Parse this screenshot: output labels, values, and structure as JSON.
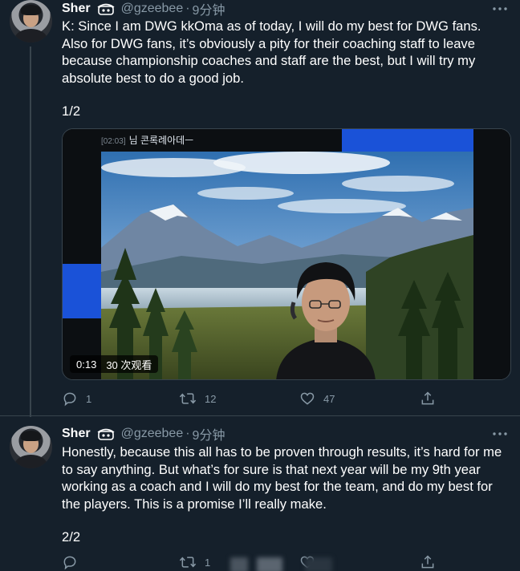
{
  "tweets": [
    {
      "author": {
        "name": "Sher",
        "handle": "@gzeebee",
        "separator": "·",
        "time": "9分钟"
      },
      "text": "K: Since I am DWG kkOma as of today, I will do my best for DWG fans. Also for DWG fans, it’s obviously a pity for their coaching staff to leave because championship coaches and staff are the best, but I will try my absolute best to do a good job.",
      "page": "1/2",
      "video": {
        "overlay_text": "님 콘록례아데ㅡ",
        "overlay_tag": "[02:03]",
        "duration": "0:13",
        "views": "30 次观看"
      },
      "actions": {
        "reply_count": "1",
        "retweet_count": "12",
        "like_count": "47"
      }
    },
    {
      "author": {
        "name": "Sher",
        "handle": "@gzeebee",
        "separator": "·",
        "time": "9分钟"
      },
      "text": "Honestly, because this all has to be proven through results, it’s hard for me to say anything. But what’s for sure is that next year will be my 9th year working as a coach and I will do my best for the team, and do my best for the players. This is a promise I’ll really make.",
      "page": "2/2",
      "actions": {
        "retweet_count": "1"
      }
    }
  ],
  "icons": {
    "more": "more-horizontal-icon",
    "reply": "reply-bubble-icon",
    "retweet": "retweet-arrows-icon",
    "like": "heart-icon",
    "share": "share-upload-icon",
    "emoji": "face-emoji-icon"
  },
  "colors": {
    "background": "#15202b",
    "secondary_text": "#8899a6",
    "divider": "#38444d",
    "video_accent": "#1a52d8"
  }
}
